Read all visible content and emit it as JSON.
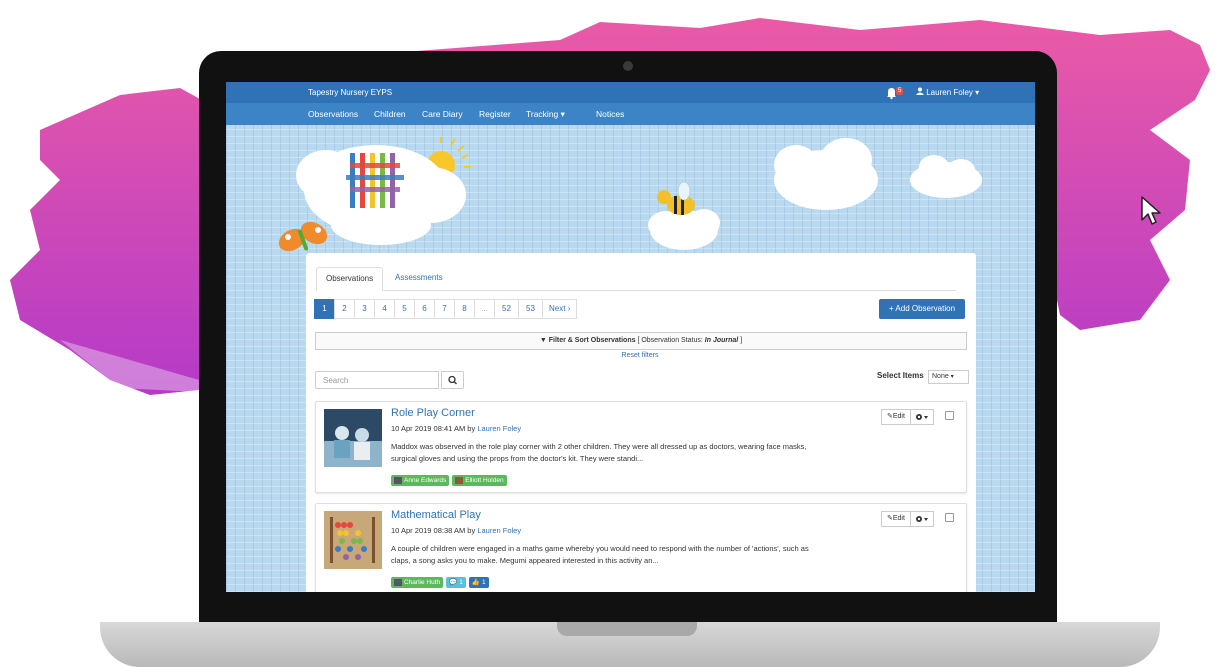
{
  "app": {
    "brand": "Tapestry Nursery EYPS",
    "notifications_count": "5",
    "user_name": "Lauren Foley"
  },
  "nav": {
    "items": [
      "Observations",
      "Children",
      "Care Diary",
      "Register",
      "Tracking",
      "Notices"
    ]
  },
  "tabs": [
    "Observations",
    "Assessments"
  ],
  "pager": {
    "pages": [
      "1",
      "2",
      "3",
      "4",
      "5",
      "6",
      "7",
      "8",
      "...",
      "52",
      "53"
    ],
    "next_label": "Next",
    "current": "1"
  },
  "toolbar": {
    "add_label": "Add Observation"
  },
  "filter": {
    "label": "Filter & Sort Observations",
    "status_prefix": "[ Observation Status:",
    "status_value": "In Journal",
    "status_suffix": "]",
    "reset_label": "Reset filters"
  },
  "search": {
    "placeholder": "Search"
  },
  "select_items": {
    "label": "Select Items",
    "value": "None"
  },
  "observations": [
    {
      "title": "Role Play Corner",
      "date": "10 Apr 2019 08:41 AM by",
      "author": "Lauren Foley",
      "text": "Maddox was observed in the role play corner with 2 other children. They were all dressed up as doctors, wearing face masks, surgical gloves and using the props from the doctor's kit. They were standi...",
      "tags": [
        "Anne Edwards",
        "Elliott Holden"
      ],
      "edit_label": "Edit"
    },
    {
      "title": "Mathematical Play",
      "date": "10 Apr 2019 08:38 AM by",
      "author": "Lauren Foley",
      "text": "A couple of children were engaged in a maths game whereby you would need to respond with the number of 'actions', such as claps, a song asks you to make. Megumi appeared interested in this activity an...",
      "tags": [
        "Charlie Huth"
      ],
      "comments": "1",
      "likes": "1",
      "edit_label": "Edit"
    }
  ],
  "colors": {
    "primary": "#2f72b6",
    "navbar": "#3c84c6",
    "success": "#5cb85c",
    "info": "#5bc0de",
    "paint": "#d94fb0"
  }
}
